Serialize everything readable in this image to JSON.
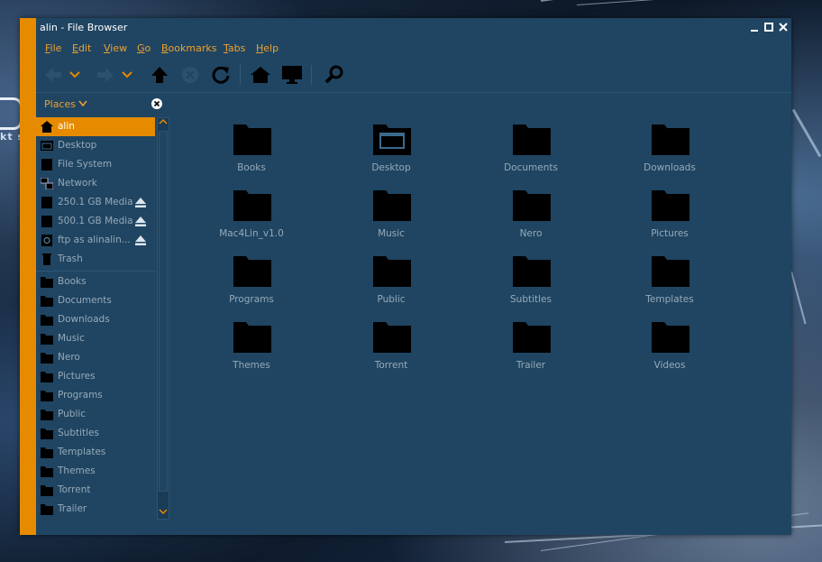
{
  "window": {
    "title": "alin - File Browser",
    "controls": {
      "minimize": "‒",
      "maximize": "□",
      "close": "✕"
    }
  },
  "menubar": [
    "File",
    "Edit",
    "View",
    "Go",
    "Bookmarks",
    "Tabs",
    "Help"
  ],
  "toolbar": [
    {
      "name": "back-icon",
      "state": "disabled"
    },
    {
      "name": "back-history-dropdown-icon",
      "state": "disabled"
    },
    {
      "name": "forward-icon",
      "state": "disabled"
    },
    {
      "name": "forward-history-dropdown-icon",
      "state": "disabled"
    },
    {
      "name": "up-icon",
      "state": "enabled"
    },
    {
      "name": "stop-icon",
      "state": "disabled"
    },
    {
      "name": "reload-icon",
      "state": "enabled"
    },
    {
      "name": "home-icon",
      "state": "enabled"
    },
    {
      "name": "computer-icon",
      "state": "enabled"
    },
    {
      "name": "search-icon",
      "state": "enabled"
    }
  ],
  "sidebar": {
    "header_label": "Places",
    "places": [
      {
        "label": "alin",
        "icon": "home-icon",
        "selected": true
      },
      {
        "label": "Desktop",
        "icon": "desktop-icon"
      },
      {
        "label": "File System",
        "icon": "drive-icon"
      },
      {
        "label": "Network",
        "icon": "network-icon"
      },
      {
        "label": "250.1 GB Media",
        "icon": "drive-icon",
        "eject": true
      },
      {
        "label": "500.1 GB Media",
        "icon": "drive-icon",
        "eject": true
      },
      {
        "label": "ftp as alinalin...",
        "icon": "ftp-icon",
        "eject": true
      },
      {
        "label": "Trash",
        "icon": "trash-icon"
      }
    ],
    "bookmarks": [
      "Books",
      "Documents",
      "Downloads",
      "Music",
      "Nero",
      "Pictures",
      "Programs",
      "Public",
      "Subtitles",
      "Templates",
      "Themes",
      "Torrent",
      "Trailer"
    ]
  },
  "files": [
    "Books",
    "Desktop",
    "Documents",
    "Downloads",
    "Mac4Lin_v1.0",
    "Music",
    "Nero",
    "Pictures",
    "Programs",
    "Public",
    "Subtitles",
    "Templates",
    "Themes",
    "Torrent",
    "Trailer",
    "Videos"
  ],
  "colors": {
    "accent": "#e68a00",
    "menu_text": "#f0a030",
    "window_bg": "#1f4562",
    "item_text": "#97a9b8"
  }
}
